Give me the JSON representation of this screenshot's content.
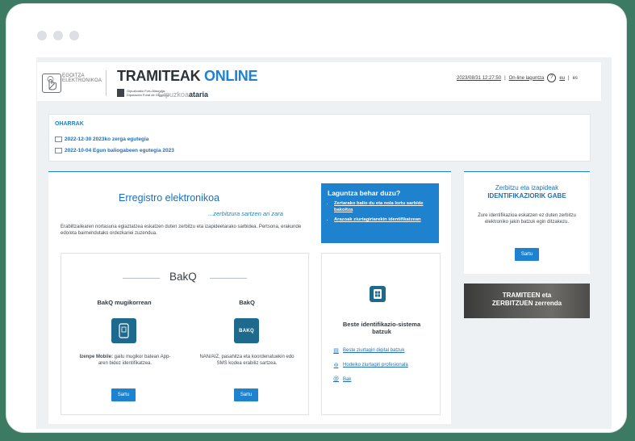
{
  "window": {
    "chrome_dots": 3
  },
  "header": {
    "logo_text_line1": "EGOITZA",
    "logo_text_line2": "ELEKTRONIKOA",
    "brand_main": "TRAMITEAK",
    "brand_accent": "ONLINE",
    "dfg_line1": "Gipuzkoako Foru Aldundia",
    "dfg_line2": "Diputación Foral de Gipuzkoa",
    "gipuzkoa_light": "Gipuzkoa",
    "gipuzkoa_bold": "ataria",
    "datetime": "2023/08/31 12:27:50",
    "online_help": "On-line laguntza",
    "help_icon": "?",
    "lang_eu": "eu",
    "lang_es": "es",
    "separator": "|"
  },
  "notes": {
    "title": "OHARRAK",
    "items": [
      "2022-12-30 2023ko zerga egutegia",
      "2022-10-04 Egun baliogabeen egutegia 2023"
    ]
  },
  "main": {
    "title": "Erregistro elektronikoa",
    "subtitle": "...zerbitzura sartzen ari zara",
    "description": "Erabiltzailearen nortasuna egiaztatzea eskatzen duten zerbitzu eta izapideetarako sarbidea. Pertsona, erakunde edo/eta baimendutako ordezkariei zuzendua.",
    "help": {
      "title": "Laguntza behar duzu?",
      "links": [
        "Zertarako balio du eta nola lortu sarbide bakoitza",
        "Arazoak ziurtagiriarekin identifikatzean"
      ]
    },
    "bakq": {
      "title": "BakQ",
      "columns": [
        {
          "title": "BakQ mugikorrean",
          "icon": "phone-icon",
          "desc_bold": "Izenpe Mobile:",
          "desc": " gailu mugikor batean App-aren bidez identifikatzea.",
          "button": "Sartu"
        },
        {
          "title": "BakQ",
          "icon_text": "BAKQ",
          "desc_bold": "",
          "desc": "NAN/AIZ, pasahitza eta koordenatuekin edo SMS kodea erabiliz sartzea.",
          "button": "Sartu"
        }
      ]
    },
    "other": {
      "title": "Beste identifikazio-sistema batzuk",
      "links": [
        {
          "icon": "card-icon",
          "label": "Beste ziurtagiri digital batzuk"
        },
        {
          "icon": "fingerprint-icon",
          "label": "Hodeiko ziurtagiri profesionala"
        },
        {
          "icon": "at-icon",
          "label": "Bak"
        }
      ]
    }
  },
  "right": {
    "title_line1": "Zerbitzu eta izapideak",
    "title_line2": "IDENTIFIKAZIORIK GABE",
    "description": "Zure identifikazioa eskatzen ez duten zerbitzu elektroniko jakin batzuk egin ditzakezu.",
    "button": "Sartu",
    "banner_line1": "TRAMITEEN eta",
    "banner_line2": "ZERBITZUEN zerrenda"
  }
}
